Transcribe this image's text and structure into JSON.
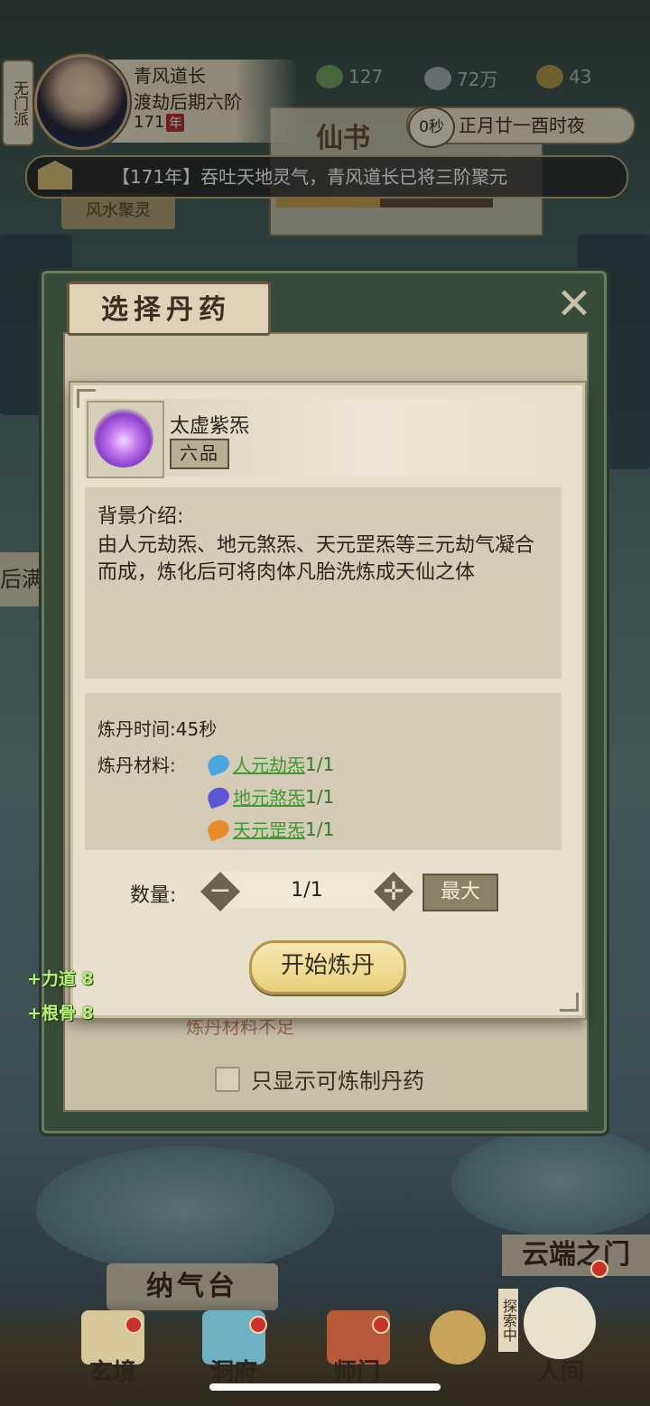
{
  "player": {
    "sect": "无门派",
    "name": "青风道长",
    "realm": "渡劫后期六阶",
    "age_value": "171",
    "age_unit": "年"
  },
  "resources": [
    {
      "icon": "leaf-icon",
      "value": "127"
    },
    {
      "icon": "coin-icon",
      "value": "72万"
    },
    {
      "icon": "ingot-icon",
      "value": "43"
    }
  ],
  "time": {
    "timer": "0秒",
    "date": "正月廿一酉时夜"
  },
  "notice": {
    "text": "【171年】吞吐天地灵气，青风道长已将三阶聚元"
  },
  "background_labels": {
    "fengshui": "风水聚灵",
    "xianshu": "仙书",
    "xianshu_progress": 0.48,
    "side_full": "后满",
    "platform": "纳气台",
    "cloud_gate": "云端之门",
    "explore": "探索中"
  },
  "outer_panel": {
    "title": "选择丹药",
    "hidden_item_status": "炼丹材料不足",
    "only_show_label": "只显示可炼制丹药"
  },
  "item": {
    "name": "太虚紫炁",
    "grade": "六品",
    "background_title": "背景介绍:",
    "background_text": "由人元劫炁、地元煞炁、天元罡炁等三元劫气凝合而成，炼化后可将肉体凡胎洗炼成天仙之体",
    "time_label": "炼丹时间:",
    "time_value": "45秒",
    "materials_label": "炼丹材料:",
    "materials": [
      {
        "name": "人元劫炁",
        "count": "1/1",
        "color": "#4aa7e0"
      },
      {
        "name": "地元煞炁",
        "count": "1/1",
        "color": "#5b57d6"
      },
      {
        "name": "天元罡炁",
        "count": "1/1",
        "color": "#e88a2c"
      }
    ]
  },
  "quantity": {
    "label": "数量:",
    "value": "1/1",
    "max_label": "最大"
  },
  "start_button": "开始炼丹",
  "buffs": [
    "+力道 8",
    "+根骨 8"
  ],
  "nav": [
    {
      "label": "玄境"
    },
    {
      "label": "洞府"
    },
    {
      "label": "师门"
    },
    {
      "label": "人间"
    }
  ],
  "colors": {
    "accent_green": "#3e9a2e",
    "button_gold": "#e8cf7c",
    "panel_dark": "#384a3a"
  }
}
